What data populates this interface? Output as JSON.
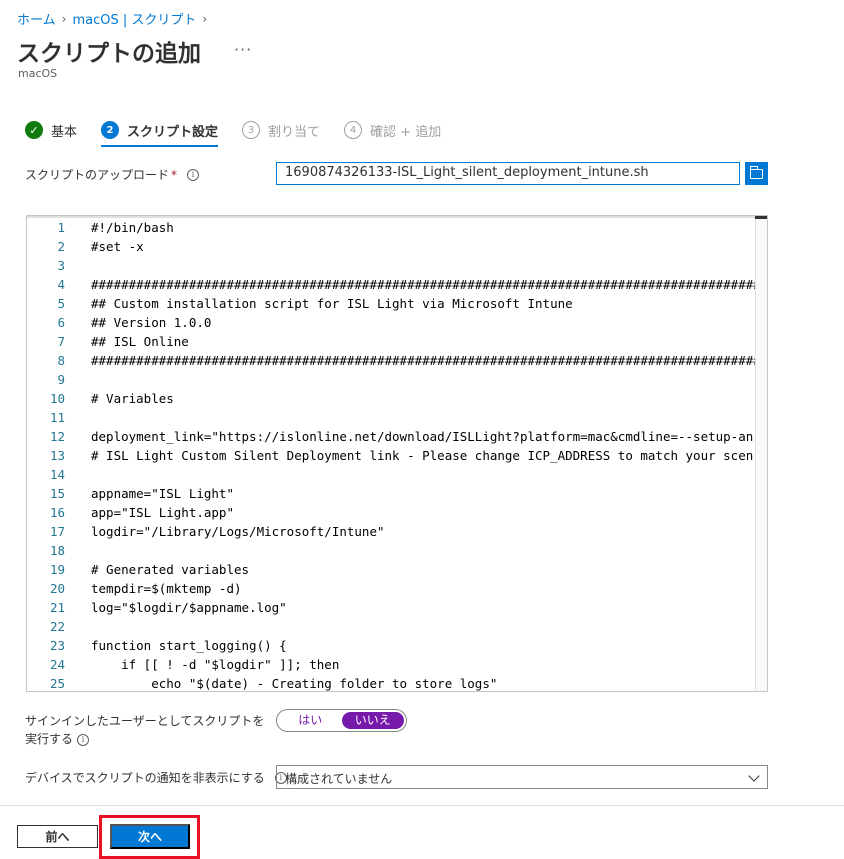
{
  "breadcrumb": {
    "home": "ホーム",
    "section": "macOS | スクリプト"
  },
  "page": {
    "title": "スクリプトの追加",
    "more": "···",
    "subtitle": "macOS"
  },
  "steps": [
    {
      "number": "✓",
      "label": "基本",
      "state": "done"
    },
    {
      "number": "2",
      "label": "スクリプト設定",
      "state": "active"
    },
    {
      "number": "3",
      "label": "割り当て",
      "state": "pending"
    },
    {
      "number": "4",
      "label": "確認 + 追加",
      "state": "pending"
    }
  ],
  "upload": {
    "label": "スクリプトのアップロード",
    "required_mark": "*",
    "info": "i",
    "filename": "1690874326133-ISL_Light_silent_deployment_intune.sh",
    "browse_icon": "folder-icon"
  },
  "code": {
    "lines": [
      {
        "n": "1",
        "t": "#!/bin/bash"
      },
      {
        "n": "2",
        "t": "#set -x"
      },
      {
        "n": "3",
        "t": ""
      },
      {
        "n": "4",
        "t": "############################################################################################"
      },
      {
        "n": "5",
        "t": "## Custom installation script for ISL Light via Microsoft Intune"
      },
      {
        "n": "6",
        "t": "## Version 1.0.0"
      },
      {
        "n": "7",
        "t": "## ISL Online"
      },
      {
        "n": "8",
        "t": "############################################################################################"
      },
      {
        "n": "9",
        "t": ""
      },
      {
        "n": "10",
        "t": "# Variables"
      },
      {
        "n": "11",
        "t": ""
      },
      {
        "n": "12",
        "t": "deployment_link=\"https://islonline.net/download/ISLLight?platform=mac&cmdline=--setup-an"
      },
      {
        "n": "13",
        "t": "# ISL Light Custom Silent Deployment link - Please change ICP_ADDRESS to match your scen"
      },
      {
        "n": "14",
        "t": ""
      },
      {
        "n": "15",
        "t": "appname=\"ISL Light\""
      },
      {
        "n": "16",
        "t": "app=\"ISL Light.app\""
      },
      {
        "n": "17",
        "t": "logdir=\"/Library/Logs/Microsoft/Intune\""
      },
      {
        "n": "18",
        "t": ""
      },
      {
        "n": "19",
        "t": "# Generated variables"
      },
      {
        "n": "20",
        "t": "tempdir=$(mktemp -d)"
      },
      {
        "n": "21",
        "t": "log=\"$logdir/$appname.log\""
      },
      {
        "n": "22",
        "t": ""
      },
      {
        "n": "23",
        "t": "function start_logging() {"
      },
      {
        "n": "24",
        "t": "    if [[ ! -d \"$logdir\" ]]; then"
      },
      {
        "n": "25",
        "t": "        echo \"$(date) - Creating folder to store logs\""
      }
    ]
  },
  "run_as_user": {
    "label": "サインインしたユーザーとしてスクリプトを実行する",
    "info": "i",
    "options": [
      "はい",
      "いいえ"
    ],
    "selected": "いいえ"
  },
  "hide_notifications": {
    "label": "デバイスでスクリプトの通知を非表示にする",
    "info": "i",
    "value": "構成されていません"
  },
  "footer": {
    "prev": "前へ",
    "next": "次へ"
  },
  "colors": {
    "accent": "#0078d4",
    "toggle": "#7719aa",
    "highlight": "#e81123",
    "done": "#107c10"
  }
}
